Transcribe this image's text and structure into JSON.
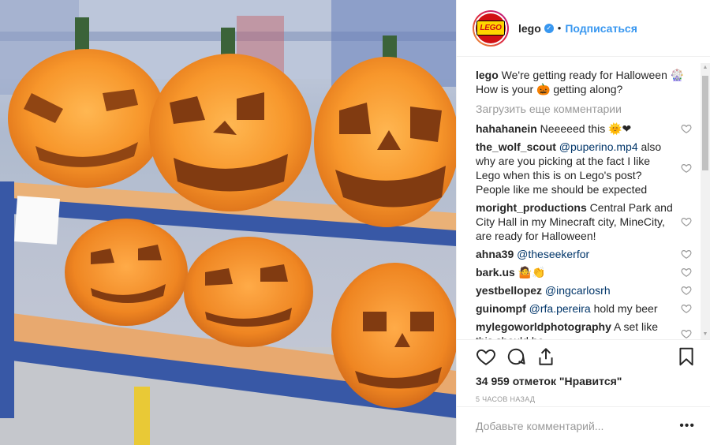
{
  "post": {
    "username": "lego",
    "verified_icon": "verified-badge-icon",
    "dot": "•",
    "follow_label": "Подписаться",
    "avatar_logo_text": "LEGO",
    "caption_user": "lego",
    "caption_text": " We're getting ready for Halloween 🎡 How is your 🎃 getting along?",
    "load_more": "Загрузить еще комментарии",
    "comments": [
      {
        "user": "hahahanein",
        "text": " Neeeeed this 🌞❤"
      },
      {
        "user": "the_wolf_scout",
        "mention": "@puperino.mp4",
        "text": " also why are you picking at the fact I like Lego when this is on Lego's post? People like me should be expected"
      },
      {
        "user": "moright_productions",
        "text": " Central Park and City Hall in my Minecraft city, MineCity, are ready for Halloween!"
      },
      {
        "user": "ahna39",
        "mention": "@theseekerfor",
        "text": ""
      },
      {
        "user": "bark.us",
        "text": " 🤷👏"
      },
      {
        "user": "yestbellopez",
        "mention": "@ingcarlosrh",
        "text": ""
      },
      {
        "user": "guinompf",
        "mention": "@rfa.pereira",
        "text": " hold my beer"
      },
      {
        "user": "mylegoworldphotography",
        "text": " A set like this should be..."
      }
    ],
    "likes": "34 959 отметок \"Нравится\"",
    "time_ago": "5 часов назад",
    "add_comment_placeholder": "Добавьте комментарий...",
    "more_label": "•••"
  },
  "colors": {
    "accent_blue": "#3897f0",
    "lego_red": "#d11013",
    "lego_yellow": "#ffd500",
    "pumpkin": "#f7901e"
  }
}
